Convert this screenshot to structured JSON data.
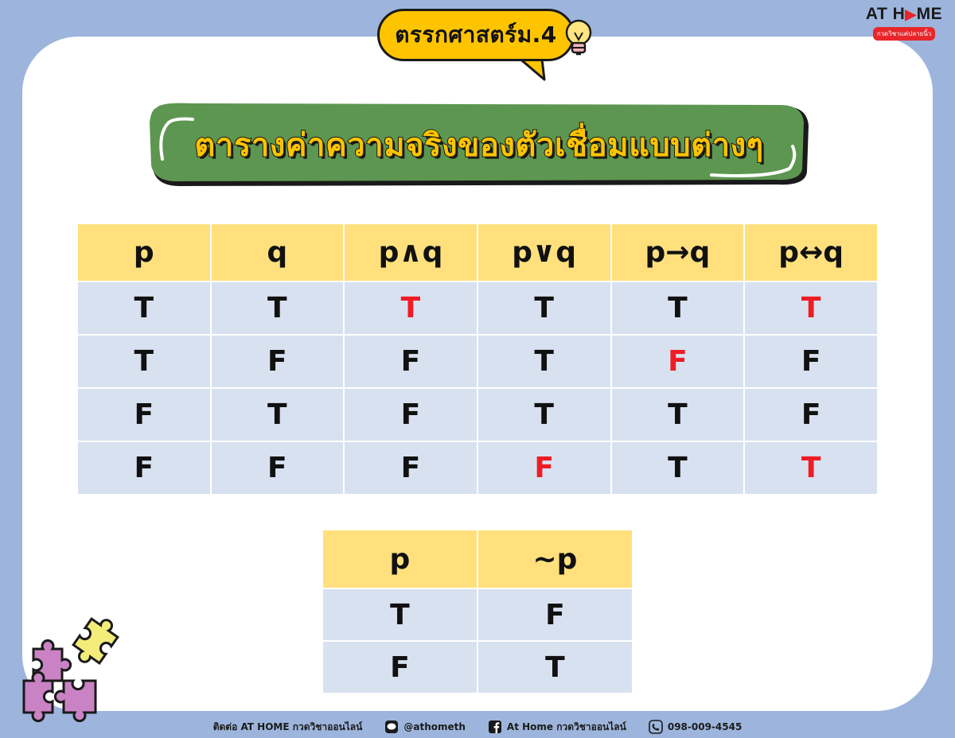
{
  "header": {
    "bubble_text": "ตรรกศาสตร์ม.4",
    "bulb_icon": "lightbulb-icon"
  },
  "logo": {
    "main_left": "AT H",
    "main_right": "ME",
    "tagline": "กวดวิชาแค่ปลายนิ้ว"
  },
  "title": "ตารางค่าความจริงของตัวเชื่อมแบบต่างๆ",
  "truth_table": {
    "headers": [
      "p",
      "q",
      "p∧q",
      "p∨q",
      "p→q",
      "p↔q"
    ],
    "rows": [
      [
        "T",
        "T",
        "T",
        "T",
        "T",
        "T"
      ],
      [
        "T",
        "F",
        "F",
        "T",
        "F",
        "F"
      ],
      [
        "F",
        "T",
        "F",
        "T",
        "T",
        "F"
      ],
      [
        "F",
        "F",
        "F",
        "F",
        "T",
        "T"
      ]
    ],
    "highlight_color": "#ee1c24"
  },
  "negation_table": {
    "headers": [
      "p",
      "~p"
    ],
    "rows": [
      [
        "T",
        "F"
      ],
      [
        "F",
        "T"
      ]
    ]
  },
  "footer": {
    "contact": "ติดต่อ AT HOME กวดวิชาออนไลน์",
    "line": "@athometh",
    "facebook": "At Home กวดวิชาออนไลน์",
    "phone": "098-009-4545"
  },
  "colors": {
    "background": "#9db5dc",
    "bubble": "#ffc400",
    "banner": "#5d9650",
    "header_cell": "#ffe07d",
    "body_cell": "#d8e1f0"
  }
}
